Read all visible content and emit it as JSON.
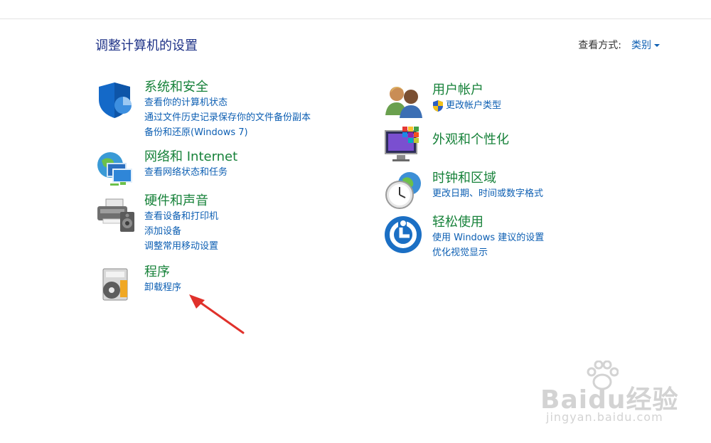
{
  "header": {
    "title": "调整计算机的设置",
    "view_by_label": "查看方式:",
    "view_by_value": "类别"
  },
  "categories": [
    {
      "title": "系统和安全",
      "icon": "shield-icon",
      "links": [
        "查看你的计算机状态",
        "通过文件历史记录保存你的文件备份副本",
        "备份和还原(Windows 7)"
      ]
    },
    {
      "title": "网络和 Internet",
      "icon": "network-icon",
      "links": [
        "查看网络状态和任务"
      ]
    },
    {
      "title": "硬件和声音",
      "icon": "printer-speaker-icon",
      "links": [
        "查看设备和打印机",
        "添加设备",
        "调整常用移动设置"
      ]
    },
    {
      "title": "程序",
      "icon": "programs-icon",
      "links": [
        "卸载程序"
      ]
    },
    {
      "title": "用户帐户",
      "icon": "users-icon",
      "links": [
        "更改帐户类型"
      ]
    },
    {
      "title": "外观和个性化",
      "icon": "monitor-palette-icon",
      "links": []
    },
    {
      "title": "时钟和区域",
      "icon": "clock-globe-icon",
      "links": [
        "更改日期、时间或数字格式"
      ]
    },
    {
      "title": "轻松使用",
      "icon": "ease-of-access-icon",
      "links": [
        "使用 Windows 建议的设置",
        "优化视觉显示"
      ]
    }
  ],
  "watermark": {
    "brand": "Baidu经验",
    "url": "jingyan.baidu.com"
  },
  "colors": {
    "title_blue": "#1e3287",
    "category_green": "#17823a",
    "link_blue": "#0d5fb3",
    "arrow_red": "#e0312b"
  }
}
